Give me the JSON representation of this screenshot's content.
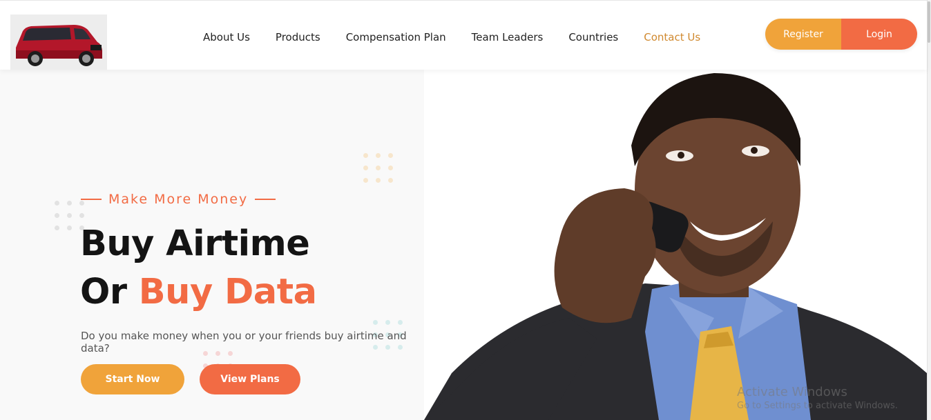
{
  "nav": {
    "items": [
      {
        "label": "About Us",
        "active": false
      },
      {
        "label": "Products",
        "active": false
      },
      {
        "label": "Compensation Plan",
        "active": false
      },
      {
        "label": "Team Leaders",
        "active": false
      },
      {
        "label": "Countries",
        "active": false
      },
      {
        "label": "Contact Us",
        "active": true
      }
    ]
  },
  "auth": {
    "register_label": "Register",
    "login_label": "Login"
  },
  "hero": {
    "eyebrow": "Make More Money",
    "headline_line1": "Buy Airtime",
    "headline_line2_prefix": "Or",
    "headline_line2_accent": "Buy Data",
    "subtext": "Do you make money when you or your friends buy airtime and data?",
    "start_label": "Start Now",
    "plans_label": "View Plans"
  },
  "watermark": {
    "line1": "Activate Windows",
    "line2": "Go to Settings to activate Windows."
  },
  "colors": {
    "accent_orange": "#f26b44",
    "accent_amber": "#f0a33a",
    "nav_active": "#d0892f"
  }
}
